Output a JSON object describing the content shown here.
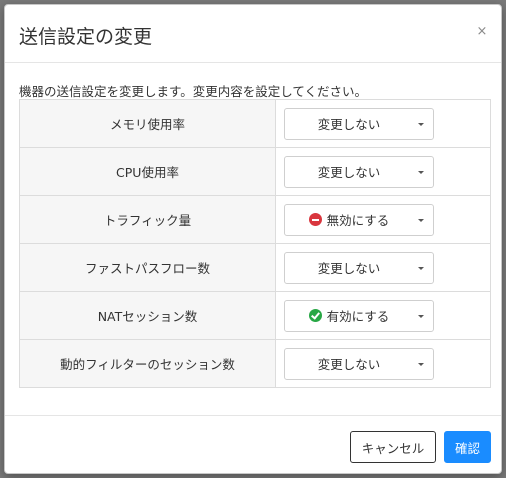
{
  "modal": {
    "title": "送信設定の変更",
    "close_label": "×",
    "description": "機器の送信設定を変更します。変更内容を設定してください。"
  },
  "settings": [
    {
      "label": "メモリ使用率",
      "value": "変更しない",
      "status_icon": ""
    },
    {
      "label": "CPU使用率",
      "value": "変更しない",
      "status_icon": ""
    },
    {
      "label": "トラフィック量",
      "value": "無効にする",
      "status_icon": "minus-circle-icon"
    },
    {
      "label": "ファストパスフロー数",
      "value": "変更しない",
      "status_icon": ""
    },
    {
      "label": "NATセッション数",
      "value": "有効にする",
      "status_icon": "check-circle-icon"
    },
    {
      "label": "動的フィルターのセッション数",
      "value": "変更しない",
      "status_icon": ""
    }
  ],
  "footer": {
    "cancel_label": "キャンセル",
    "confirm_label": "確認"
  },
  "colors": {
    "primary": "#1a8cff",
    "danger": "#d9363e",
    "success": "#28a745"
  }
}
